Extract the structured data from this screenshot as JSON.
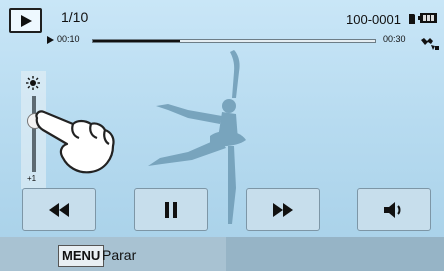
{
  "top_bar": {
    "counter": "1/10",
    "file_number": "100-0001",
    "elapsed_time": "00:10",
    "total_time": "00:30",
    "progress_fraction": 0.31
  },
  "brightness": {
    "value_label": "+1",
    "level_fraction": 0.7
  },
  "controls": [
    {
      "icon": "rewind-icon"
    },
    {
      "icon": "pause-icon"
    },
    {
      "icon": "fast-forward-icon"
    },
    {
      "icon": "volume-icon"
    }
  ],
  "bottom_bar": {
    "menu_key": "MENU",
    "menu_action": "Parar"
  },
  "colors": {
    "background": "#b7dbf0",
    "button": "#c7deec",
    "silhouette": "#6e9bb5",
    "dark": "#111111"
  }
}
